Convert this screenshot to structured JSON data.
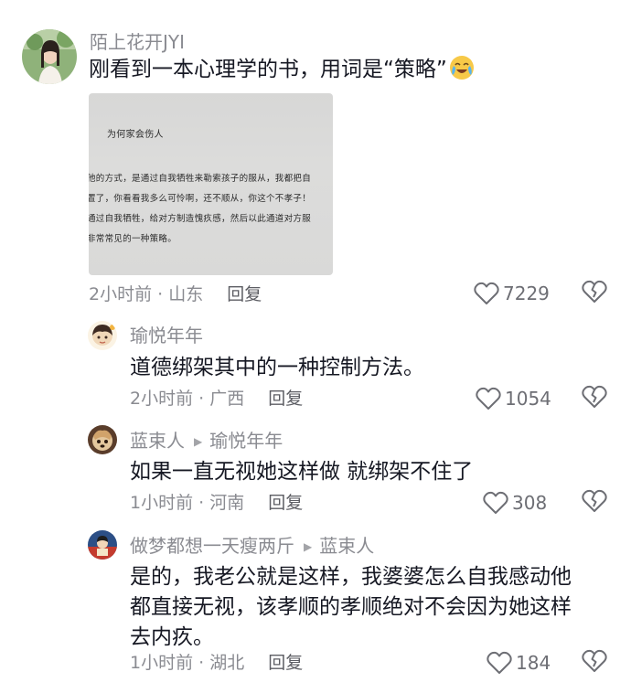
{
  "comments": [
    {
      "user": "陌上花开JYI",
      "text": "刚看到一本心理学的书，用词是“策略”",
      "emoji": "crying-laughing-emoji",
      "time_location": "2小时前 · 山东",
      "reply_label": "回复",
      "likes": "7229",
      "image": {
        "title": "为何家会伤人",
        "lines": [
          "他的方式，是通过自我牺牲来勒索孩子的服从，我都把自",
          "置了，你看看我多么可怜啊，还不顺从，你这个不孝子！",
          "通过自我牺牲，给对方制造愧疚感，然后以此通道对方服",
          "非常常见的一种策略。"
        ]
      }
    },
    {
      "user": "瑜悦年年",
      "text": "道德绑架其中的一种控制方法。",
      "time_location": "2小时前 · 广西",
      "reply_label": "回复",
      "likes": "1054"
    },
    {
      "user": "蓝束人",
      "reply_to": "瑜悦年年",
      "text": "如果一直无视她这样做 就绑架不住了",
      "time_location": "1小时前 · 河南",
      "reply_label": "回复",
      "likes": "308"
    },
    {
      "user": "做梦都想一天瘦两斤",
      "reply_to": "蓝束人",
      "text_lines": [
        "是的，我老公就是这样，我婆婆怎么自我感动他",
        "都直接无视，该孝顺的孝顺绝对不会因为她这样",
        "去内疚。"
      ],
      "time_location": "1小时前 · 湖北",
      "reply_label": "回复",
      "likes": "184"
    }
  ],
  "colors": {
    "primary_text": "#161823",
    "secondary_text": "#8a8b91",
    "reply_text": "#5c5d63",
    "background": "#ffffff"
  }
}
